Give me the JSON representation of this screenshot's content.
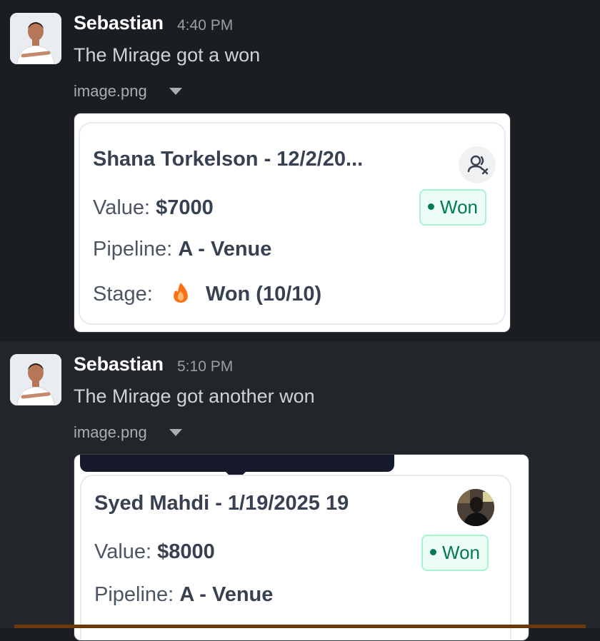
{
  "messages": [
    {
      "author": "Sebastian",
      "time": "4:40 PM",
      "text": "The Mirage got a won",
      "attachment": {
        "filename": "image.png",
        "card": {
          "title": "Shana Torkelson - 12/2/20...",
          "value_label": "Value:",
          "value": "$7000",
          "pipeline_label": "Pipeline:",
          "pipeline": "A - Venue",
          "stage_label": "Stage:",
          "stage": "Won (10/10)",
          "status": "Won",
          "icon": "contact-remove-icon"
        }
      }
    },
    {
      "author": "Sebastian",
      "time": "5:10 PM",
      "text": "The Mirage got another won",
      "attachment": {
        "filename": "image.png",
        "card": {
          "title": "Syed Mahdi - 1/19/2025 19",
          "value_label": "Value:",
          "value": "$8000",
          "pipeline_label": "Pipeline:",
          "pipeline": "A - Venue",
          "status": "Won",
          "icon": "contact-avatar"
        }
      }
    }
  ],
  "colors": {
    "background": "#1a1d21",
    "won_text": "#047857",
    "won_bg": "#ecfdf5",
    "fire": "#f97316"
  }
}
